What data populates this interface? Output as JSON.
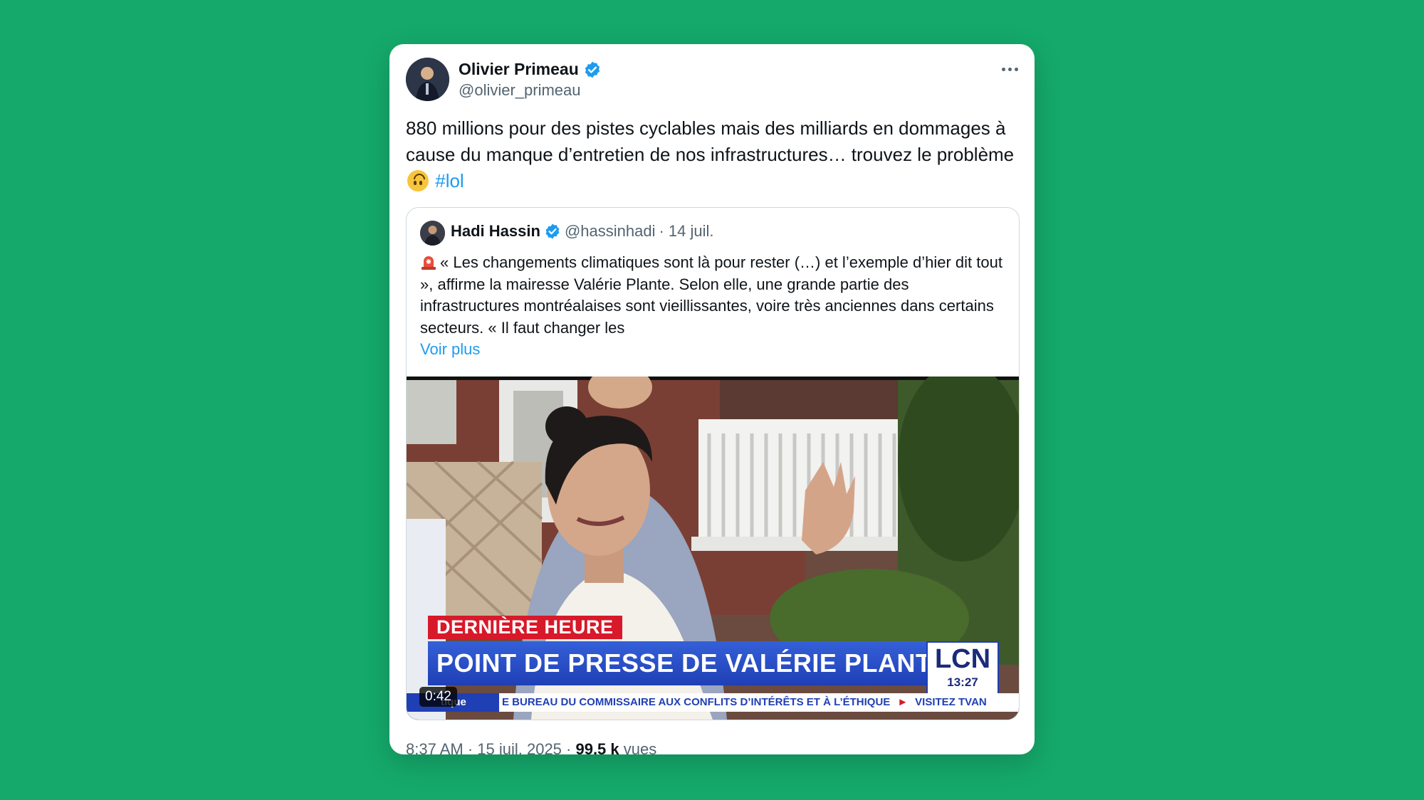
{
  "tweet": {
    "author_name": "Olivier Primeau",
    "author_handle": "@olivier_primeau",
    "text_before": "880 millions pour des pistes cyclables mais des milliards en dommages à cause du manque d’entretien de nos infrastructures… trouvez le problème ",
    "hashtag": "#lol",
    "emoji": "upside-down-face",
    "timestamp": "8:37 AM · 15 juil. 2025 · ",
    "views_count": "99,5 k",
    "views_label": " vues"
  },
  "quote": {
    "author_name": "Hadi Hassin",
    "author_handle": "@hassinhadi",
    "date": "· 14 juil.",
    "text": "« Les changements climatiques sont là pour rester (…) et l’exemple d’hier dit tout », affirme la mairesse Valérie Plante. Selon elle, une grande partie des infrastructures montréalaises sont vieillissantes, voire très anciennes dans certains secteurs. « Il faut changer les",
    "more_label": "Voir plus",
    "icon": "rotating-light-icon"
  },
  "video": {
    "tag": "DERNIÈRE HEURE",
    "headline": "POINT DE PRESSE DE VALÉRIE PLANTE",
    "channel": "LCN",
    "clock": "13:27",
    "ticker_label": "tique",
    "ticker_text": "E BUREAU DU COMMISSAIRE AUX CONFLITS D’INTÉRÊTS ET À L’ÉTHIQUE",
    "ticker_arrow": "►",
    "ticker_text_2": "VISITEZ TVAN",
    "duration": "0:42"
  },
  "colors": {
    "background": "#15a96b",
    "accent": "#1d9bf0",
    "verified": "#1d9bf0",
    "breaking_red": "#d7192a",
    "lcn_blue": "#1f3fb5"
  }
}
